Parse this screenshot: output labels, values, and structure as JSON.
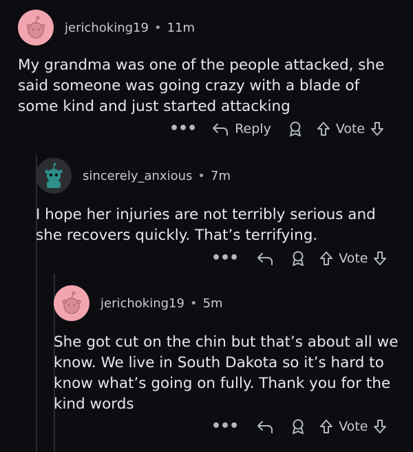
{
  "comments": [
    {
      "username": "jerichoking19",
      "time": "11m",
      "text": "My grandma was one of the people attacked, she said someone was going crazy with a blade of some kind and just started attacking",
      "reply_label": "Reply",
      "vote_label": "Vote"
    },
    {
      "username": "sincerely_anxious",
      "time": "7m",
      "text": "I hope her injuries are not terribly serious and she recovers quickly. That’s terrifying.",
      "vote_label": "Vote"
    },
    {
      "username": "jerichoking19",
      "time": "5m",
      "text": "She got cut on the chin but that’s about all we know. We live in South Dakota so it’s hard to know what’s going on fully. Thank you for the kind words",
      "vote_label": "Vote"
    }
  ],
  "separator": "•",
  "more_glyph": "•••",
  "icons": {
    "more": "more-icon",
    "reply": "reply-arrow-icon",
    "award": "award-icon",
    "upvote": "upvote-arrow-icon",
    "downvote": "downvote-arrow-icon"
  },
  "colors": {
    "background": "#0c0d10",
    "avatar_pink": "#f2a5ae",
    "avatar_teal": "#2f8f8a"
  }
}
